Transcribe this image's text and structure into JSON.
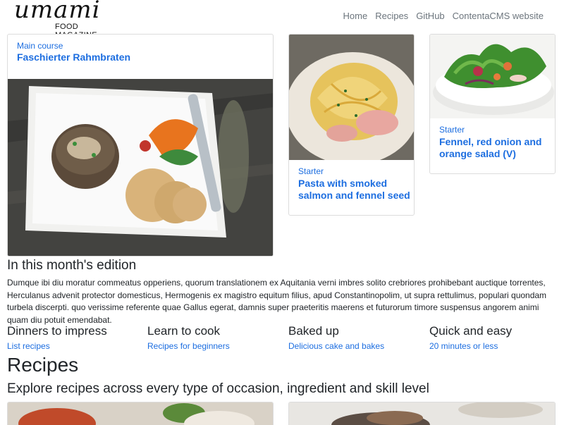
{
  "brand": {
    "logo_text": "umami",
    "tagline": "FOOD MAGAZINE"
  },
  "nav": [
    "Home",
    "Recipes",
    "GitHub",
    "ContentaCMS website"
  ],
  "featured": {
    "category": "Main course",
    "title": "Faschierter Rahmbraten"
  },
  "cards": [
    {
      "category": "Starter",
      "title": "Pasta with smoked salmon and fennel seed"
    },
    {
      "category": "Starter",
      "title": "Fennel, red onion and orange salad (V)"
    }
  ],
  "edition": {
    "heading": "In this month's edition",
    "body": "Dumque ibi diu moratur commeatus opperiens, quorum translationem ex Aquitania verni imbres solito crebriores prohibebant auctique torrentes, Herculanus advenit protector domesticus, Hermogenis ex magistro equitum filius, apud Constantinopolim, ut supra rettulimus, populari quondam turbela discerpti. quo verissime referente quae Gallus egerat, damnis super praeteritis maerens et futurorum timore suspensus angorem animi quam diu potuit emendabat."
  },
  "columns": [
    {
      "heading": "Dinners to impress",
      "link": "List recipes"
    },
    {
      "heading": "Learn to cook",
      "link": "Recipes for beginners"
    },
    {
      "heading": "Baked up",
      "link": "Delicious cake and bakes"
    },
    {
      "heading": "Quick and easy",
      "link": "20 minutes or less"
    }
  ],
  "recipes": {
    "heading": "Recipes",
    "subheading": "Explore recipes across every type of occasion, ingredient and skill level"
  },
  "colors": {
    "link": "#1d6ee0",
    "nav": "#6c757d",
    "text": "#212529",
    "border": "#dcdcdc"
  }
}
